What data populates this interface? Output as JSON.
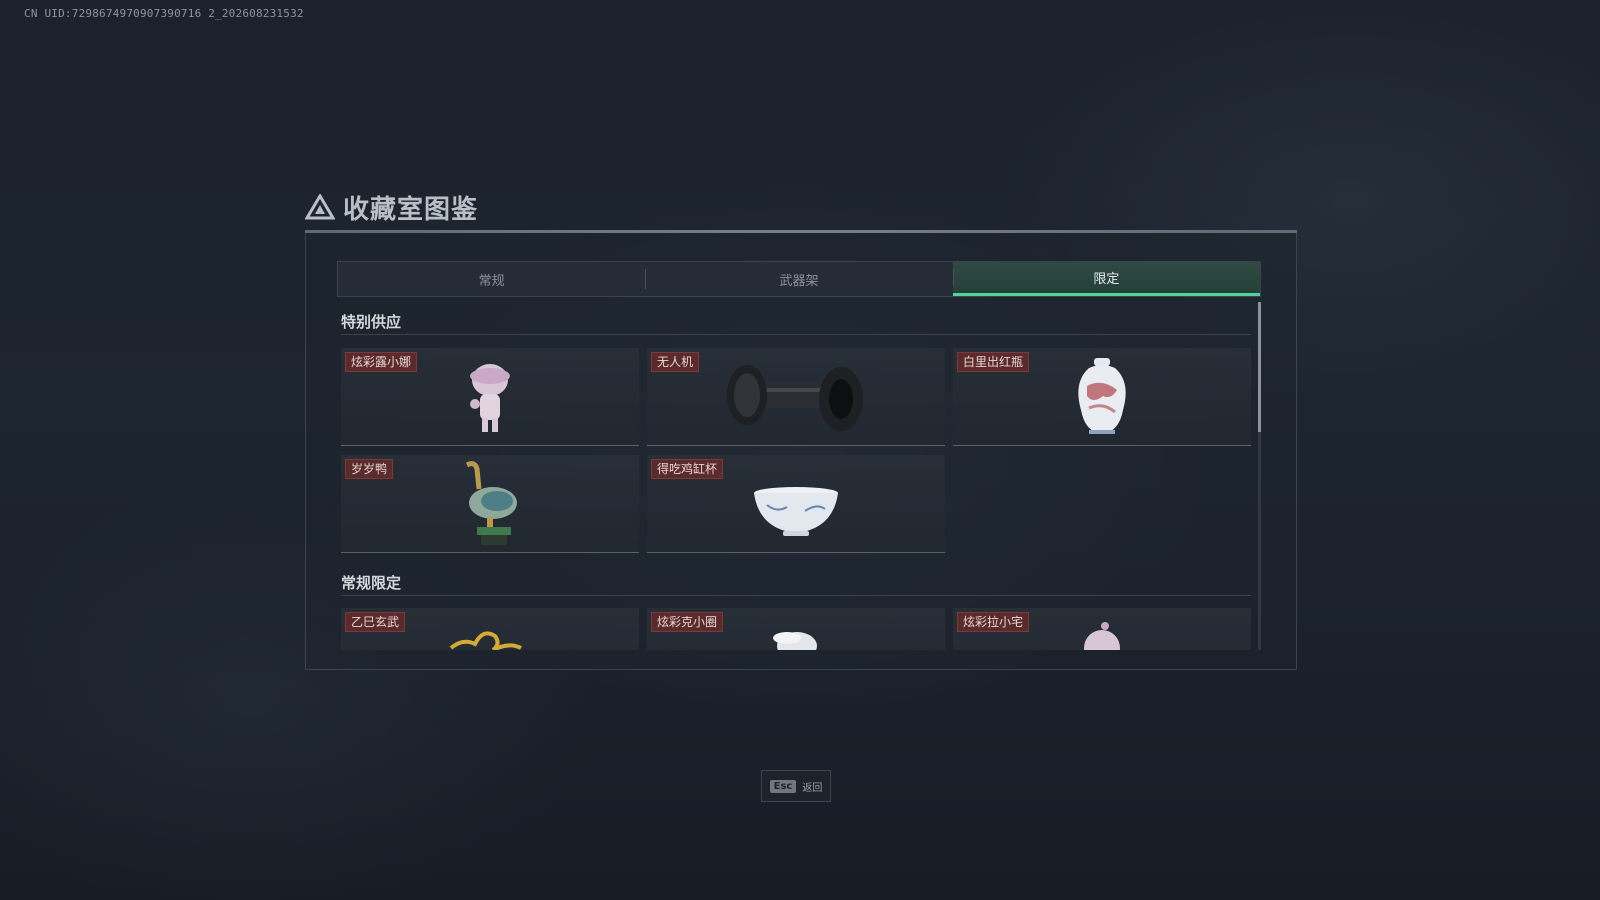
{
  "uid_text": "CN UID:7298674970907390716 2_202608231532",
  "window": {
    "title": "收藏室图鉴"
  },
  "tabs": [
    {
      "label": "常规",
      "active": false
    },
    {
      "label": "武器架",
      "active": false
    },
    {
      "label": "限定",
      "active": true
    }
  ],
  "sections": [
    {
      "title": "特别供应",
      "items": [
        {
          "label": "炫彩露小娜",
          "icon": "pink-figurine-icon"
        },
        {
          "label": "无人机",
          "icon": "drone-wheels-icon"
        },
        {
          "label": "白里出红瓶",
          "icon": "red-white-vase-icon"
        },
        {
          "label": "岁岁鸭",
          "icon": "bronze-duck-icon"
        },
        {
          "label": "得吃鸡缸杯",
          "icon": "porcelain-bowl-icon"
        }
      ]
    },
    {
      "title": "常规限定",
      "items": [
        {
          "label": "乙巳玄武",
          "icon": "golden-serpent-icon"
        },
        {
          "label": "炫彩克小圈",
          "icon": "white-cap-figurine-icon"
        },
        {
          "label": "炫彩拉小宅",
          "icon": "pink-head-figurine-icon"
        }
      ]
    }
  ],
  "footer": {
    "esc_key": "Esc",
    "esc_label": "返回"
  },
  "colors": {
    "active_tab_accent": "#4fd39a",
    "tag_bg": "#5b2b2b"
  }
}
